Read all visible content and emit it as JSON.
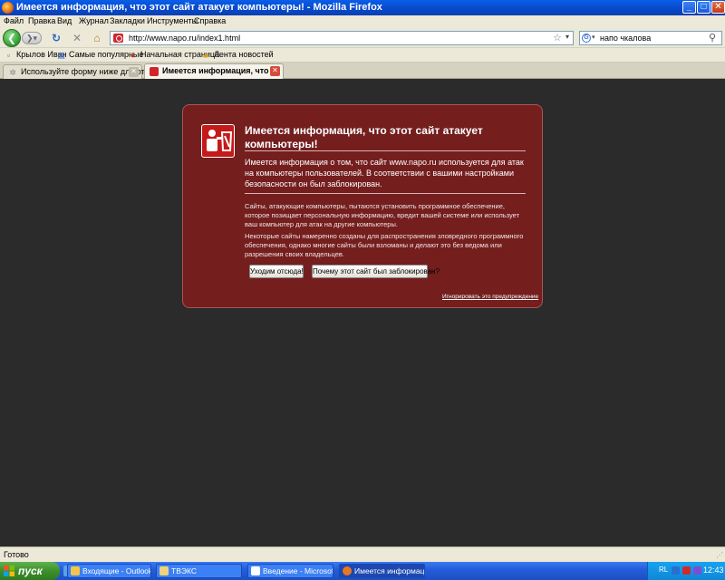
{
  "window": {
    "title": "Имеется информация, что этот сайт атакует компьютеры! - Mozilla Firefox",
    "min_glyph": "_",
    "max_glyph": "□",
    "close_glyph": "✕"
  },
  "menu": [
    "Файл",
    "Правка",
    "Вид",
    "Журнал",
    "Закладки",
    "Инструменты",
    "Справка"
  ],
  "nav": {
    "back_glyph": "❮",
    "forward_glyph": "❯▾",
    "reload_glyph": "↻",
    "stop_glyph": "✕",
    "home_glyph": "⌂",
    "url": "http://www.napo.ru/index1.html",
    "star_glyph": "☆",
    "dropdown_glyph": "▾",
    "search_engine_glyph": "G",
    "search_query": "напо чкалова",
    "search_glyph": "⚲"
  },
  "bookmarks": [
    {
      "label": "Крылов Иван",
      "icon": "page-icon"
    },
    {
      "label": "Самые популярные",
      "icon": "bookmark-icon"
    },
    {
      "label": "Начальная страница",
      "icon": "firefox-icon"
    },
    {
      "label": "Лента новостей",
      "icon": "rss-folder-icon"
    }
  ],
  "tabs": [
    {
      "label": "Используйте форму ниже для отпра...",
      "active": false
    },
    {
      "label": "Имеется информация, что ...",
      "active": true
    }
  ],
  "error_page": {
    "title": "Имеется информация, что этот сайт атакует компьютеры!",
    "intro": "Имеется информация о том, что сайт www.napo.ru используется для атак на компьютеры пользователей. В соответствии с вашими настройками безопасности он был заблокирован.",
    "detail1": "Сайты, атакующие компьютеры, пытаются установить программное обеспечение, которое позищает персональную информацию, вредит вашей системе или использует ваш компьютер для атак на другие компьютеры.",
    "detail2": "Некоторые сайты намеренно созданы для распространения зловредного программного обеспечения, однако многие сайты были взломаны и делают это без ведома или разрешения своих владельцев.",
    "leave_button": "Уходим отсюда!",
    "why_button": "Почему этот сайт был заблокирован?",
    "ignore_link": "Игнорировать это предупреждение",
    "accent_color": "#741e1e"
  },
  "status": {
    "text": "Готово"
  },
  "taskbar": {
    "start_label": "пуск",
    "tasks": [
      {
        "label": "Входящие - Outlook ...",
        "active": false
      },
      {
        "label": "ТВЭКС",
        "active": false
      },
      {
        "label": "Введение - Microsoft...",
        "active": false
      },
      {
        "label": "Имеется информаци...",
        "active": true
      }
    ],
    "lang": "RL",
    "clock": "12:43"
  }
}
